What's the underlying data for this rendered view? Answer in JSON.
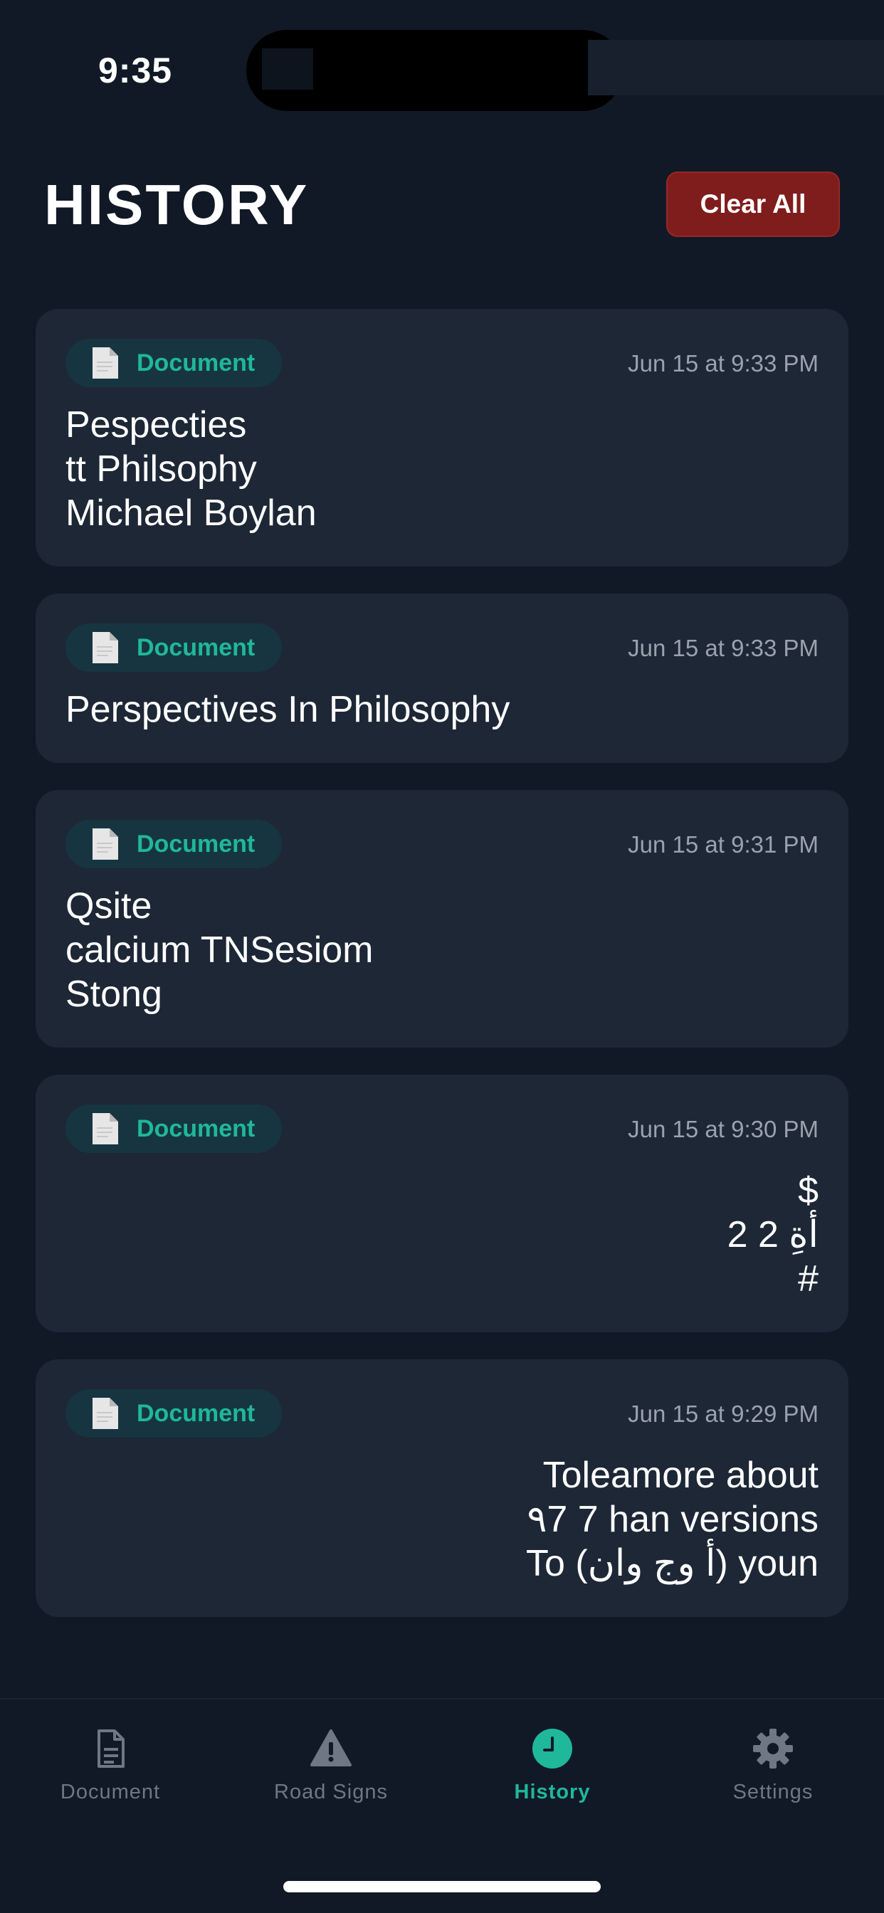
{
  "status_bar": {
    "time": "9:35"
  },
  "header": {
    "title": "HISTORY",
    "clear_all_label": "Clear All"
  },
  "history": [
    {
      "type": "Document",
      "timestamp": "Jun 15 at 9:33 PM",
      "lines": [
        "Pespecties",
        "tt Philsophy",
        "Michael Boylan"
      ]
    },
    {
      "type": "Document",
      "timestamp": "Jun 15 at 9:33 PM",
      "lines": [
        "Perspectives In Philosophy"
      ]
    },
    {
      "type": "Document",
      "timestamp": "Jun 15 at 9:31 PM",
      "lines": [
        "Qsite",
        "calcium TNSesiom",
        "Stong"
      ]
    },
    {
      "type": "Document",
      "timestamp": "Jun 15 at 9:30 PM",
      "lines": [
        "$",
        "أةِ 2 2",
        "#"
      ]
    },
    {
      "type": "Document",
      "timestamp": "Jun 15 at 9:29 PM",
      "lines": [
        "Toleamore about",
        "٩7 7 han versions",
        "To (أ وج وان) youn"
      ]
    }
  ],
  "tabs": [
    {
      "label": "Document",
      "icon": "document-icon"
    },
    {
      "label": "Road Signs",
      "icon": "warning-icon"
    },
    {
      "label": "History",
      "icon": "clock-icon"
    },
    {
      "label": "Settings",
      "icon": "gear-icon"
    }
  ],
  "colors": {
    "background": "#111927",
    "card": "#1d2736",
    "accent": "#1fb89b",
    "danger": "#7f1d1d",
    "inactive": "#6f7784"
  }
}
